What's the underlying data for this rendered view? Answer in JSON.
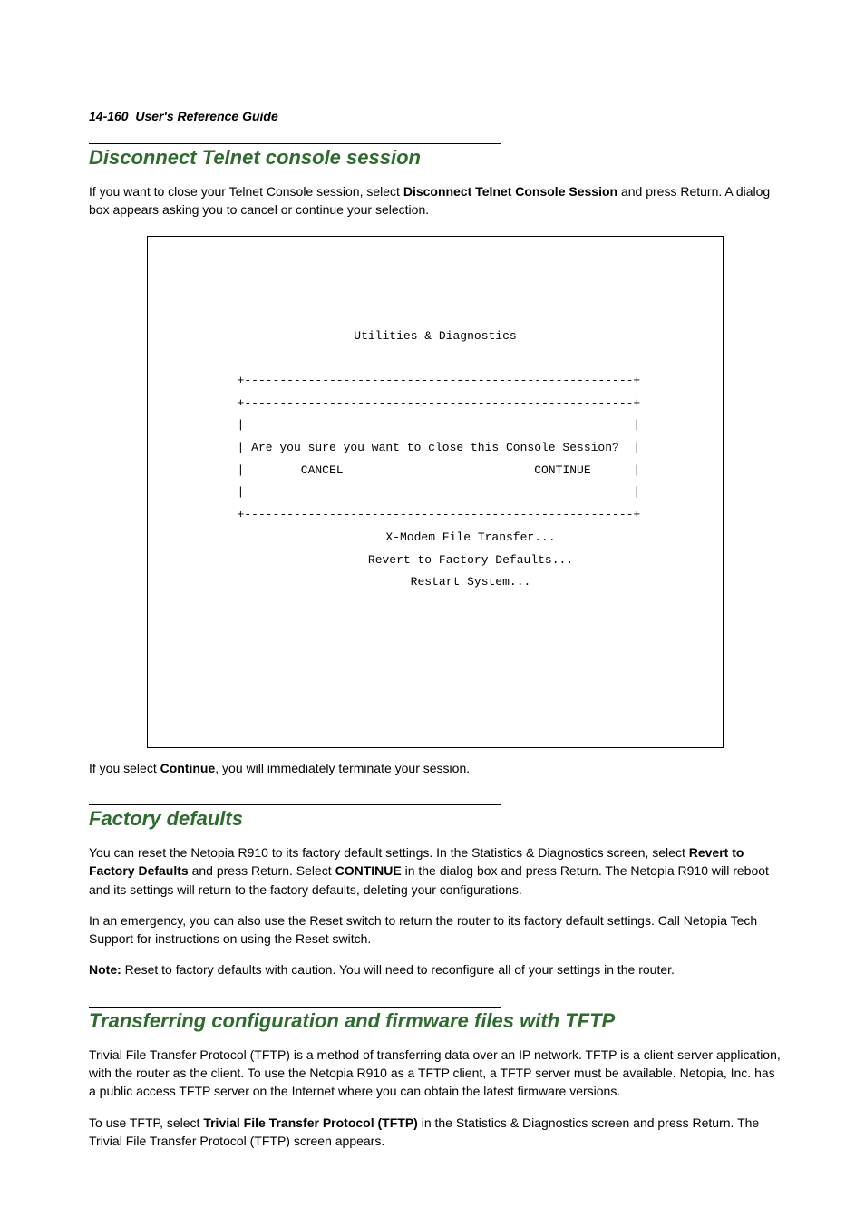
{
  "header": {
    "page_ref": "14-160",
    "guide_title": "User's Reference Guide"
  },
  "section1": {
    "title": "Disconnect Telnet console session",
    "p1_a": "If you want to close your Telnet Console session, select ",
    "p1_bold": "Disconnect Telnet Console Session",
    "p1_b": " and press Return. A dialog box appears asking you to cancel or continue your selection.",
    "terminal": {
      "title": "Utilities & Diagnostics",
      "border_top": " +-------------------------------------------------------+",
      "border_top2": " +-------------------------------------------------------+",
      "border_side_blank": " |                                                       |",
      "question": " | Are you sure you want to close this Console Session?  |",
      "buttons": " |        CANCEL                           CONTINUE      |",
      "border_bottom": " +-------------------------------------------------------+",
      "opt1": "          X-Modem File Transfer...",
      "opt2": "          Revert to Factory Defaults...",
      "opt3": "          Restart System..."
    },
    "p2_a": "If you select ",
    "p2_bold": "Continue",
    "p2_b": ", you will immediately terminate your session."
  },
  "section2": {
    "title": "Factory defaults",
    "p1_a": "You can reset the Netopia R910 to its factory default settings. In the Statistics & Diagnostics screen, select ",
    "p1_bold1": "Revert to Factory Defaults",
    "p1_b": " and press Return. Select ",
    "p1_bold2": "CONTINUE",
    "p1_c": " in the dialog box and press Return. The Netopia R910 will reboot and its settings will return to the factory defaults, deleting your configurations.",
    "p2": "In an emergency, you can also use the Reset switch to return the router to its factory default settings. Call Netopia Tech Support for instructions on using the Reset switch.",
    "p3_bold": "Note:",
    "p3": " Reset to factory defaults with caution. You will need to reconfigure all of your settings in the router."
  },
  "section3": {
    "title": "Transferring configuration and firmware files with TFTP",
    "p1": "Trivial File Transfer Protocol (TFTP) is a method of transferring data over an IP network. TFTP is a client-server application, with the router as the client. To use the Netopia R910 as a TFTP client, a TFTP server must be available. Netopia, Inc. has a public access TFTP server on the Internet where you can obtain the latest firmware versions.",
    "p2_a": "To use TFTP, select ",
    "p2_bold": "Trivial File Transfer Protocol (TFTP)",
    "p2_b": " in the Statistics & Diagnostics screen and press Return. The Trivial File Transfer Protocol (TFTP) screen appears."
  }
}
